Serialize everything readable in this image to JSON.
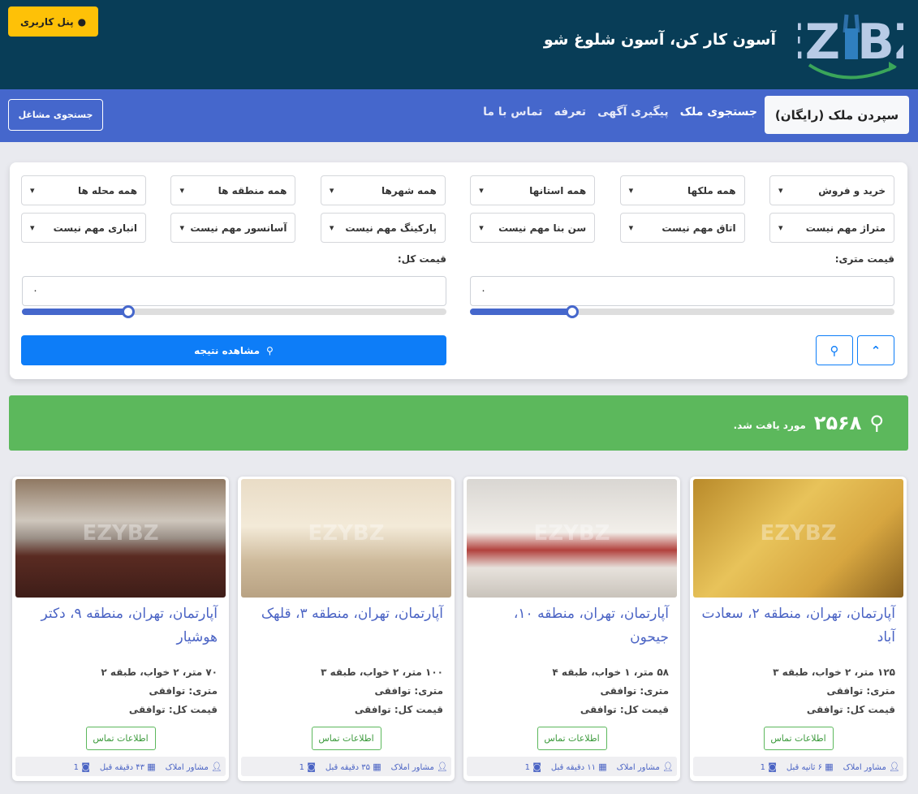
{
  "header": {
    "logo_text": "EZYBZ",
    "tagline": "آسون کار کن، آسون شلوغ شو",
    "panel_button": "پنل کاربری"
  },
  "nav": {
    "active": "سپردن ملک (رایگان)",
    "links": [
      "جستجوی ملک",
      "پیگیری آگهی",
      "تعرفه",
      "تماس با ما"
    ],
    "jobs_button": "جستجوی مشاغل"
  },
  "filters": {
    "selects": [
      "خرید و فروش",
      "همه ملکها",
      "همه استانها",
      "همه شهرها",
      "همه منطقه ها",
      "همه محله ها",
      "متراژ مهم نیست",
      "اتاق مهم نیست",
      "سن بنا مهم نیست",
      "پارکینگ مهم نیست",
      "آسانسور مهم نیست",
      "انباری مهم نیست"
    ],
    "unit_price_label": "قیمت متری:",
    "unit_price_value": "۰",
    "unit_price_slider": 0.24,
    "total_price_label": "قیمت کل:",
    "total_price_value": "۰",
    "total_price_slider": 0.25,
    "result_button": "مشاهده نتیجه"
  },
  "results": {
    "count": "۲۵۶۸",
    "text": "مورد یافت شد."
  },
  "listings": [
    {
      "title": "آپارتمان، تهران، منطقه ۲، سعادت آباد",
      "specs": "۱۲۵ متر، ۲ خواب، طبقه ۳",
      "unit_price": "متری: توافقی",
      "total_price": "قیمت کل: توافقی",
      "contact": "اطلاعات تماس",
      "agent": "مشاور املاک",
      "time": "۶ ثانیه قبل",
      "photos": "1",
      "img": "linear-gradient(135deg,#b98a2a,#e8c35a 40%,#d7a640 70%,#8a6220)"
    },
    {
      "title": "آپارتمان، تهران، منطقه ۱۰، جیحون",
      "specs": "۵۸ متر، ۱ خواب، طبقه ۴",
      "unit_price": "متری: توافقی",
      "total_price": "قیمت کل: توافقی",
      "contact": "اطلاعات تماس",
      "agent": "مشاور املاک",
      "time": "۱۱ دقیقه قبل",
      "photos": "1",
      "img": "linear-gradient(180deg,#d9d6d2,#f2efea 45%,#b2413d 60%,#e7e2dc 75%,#c9c3bb)"
    },
    {
      "title": "آپارتمان، تهران، منطقه ۳، قلهک",
      "specs": "۱۰۰ متر، ۲ خواب، طبقه ۳",
      "unit_price": "متری: توافقی",
      "total_price": "قیمت کل: توافقی",
      "contact": "اطلاعات تماس",
      "agent": "مشاور املاک",
      "time": "۳۵ دقیقه قبل",
      "photos": "1",
      "img": "linear-gradient(180deg,#e9dcc6,#f3ead8 40%,#cdb99a 70%,#b8a283)"
    },
    {
      "title": "آپارتمان، تهران، منطقه ۹، دکتر هوشیار",
      "specs": "۷۰ متر، ۲ خواب، طبقه ۲",
      "unit_price": "متری: توافقی",
      "total_price": "قیمت کل: توافقی",
      "contact": "اطلاعات تماس",
      "agent": "مشاور املاک",
      "time": "۴۳ دقیقه قبل",
      "photos": "1",
      "img": "linear-gradient(180deg,#8f7862,#cfc7bd 35%,#9a8f86 50%,#5a2b22 65%,#3e1d18)"
    }
  ],
  "colors": {
    "header": "#083d57",
    "nav": "#4567cc",
    "accent": "#0d7df8",
    "success": "#5cb85c",
    "warning": "#fec107"
  }
}
